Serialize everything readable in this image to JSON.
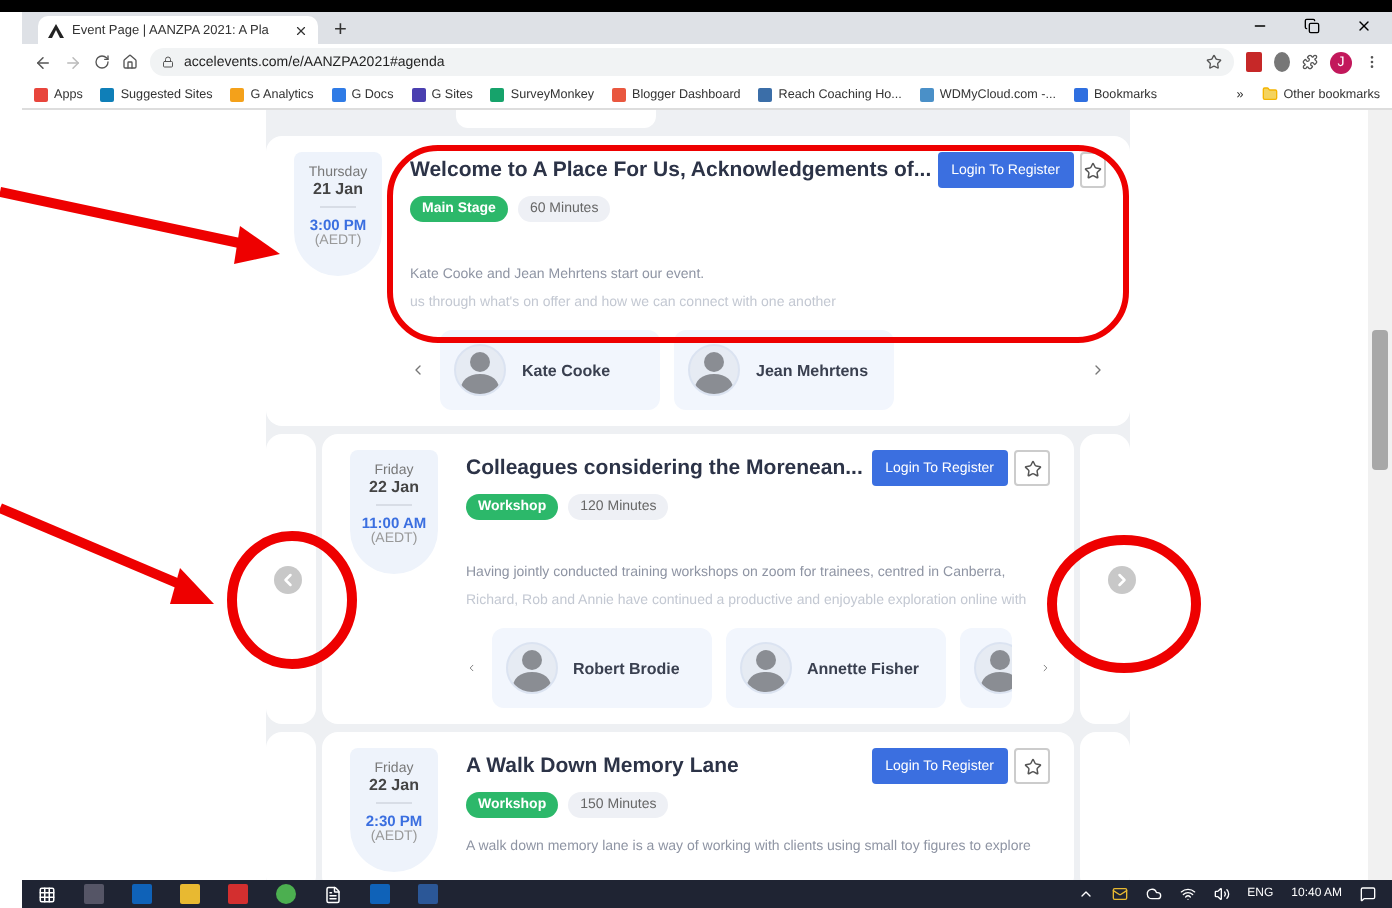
{
  "browser": {
    "tab_title": "Event Page | AANZPA 2021: A Pla",
    "new_tab": "+",
    "url": "accelevents.com/e/AANZPA2021#agenda",
    "avatar_initial": "J",
    "bookmarks": [
      {
        "label": "Apps",
        "color": "#e8453c"
      },
      {
        "label": "Suggested Sites",
        "color": "#0f7fb8"
      },
      {
        "label": "G Analytics",
        "color": "#f4a11a"
      },
      {
        "label": "G Docs",
        "color": "#2f7be6"
      },
      {
        "label": "G Sites",
        "color": "#4a3fb0"
      },
      {
        "label": "SurveyMonkey",
        "color": "#16a36b"
      },
      {
        "label": "Blogger Dashboard",
        "color": "#e9573f"
      },
      {
        "label": "Reach Coaching Ho...",
        "color": "#3b6ea8"
      },
      {
        "label": "WDMyCloud.com -...",
        "color": "#4a90c8"
      },
      {
        "label": "Bookmarks",
        "color": "#2f6fe0"
      }
    ],
    "overflow": "»",
    "other_bookmarks": "Other bookmarks"
  },
  "sessions": [
    {
      "day": "Thursday",
      "date": "21 Jan",
      "time": "3:00 PM",
      "zone": "(AEDT)",
      "title": "Welcome to A Place For Us, Acknowledgements of...",
      "button": "Login To Register",
      "track": "Main Stage",
      "duration": "60 Minutes",
      "carousel": false,
      "description": [
        "Kate Cooke and Jean Mehrtens start our event.",
        "us through what's on offer and how we can connect with one another"
      ],
      "speakers": [
        "Kate Cooke",
        "Jean Mehrtens"
      ]
    },
    {
      "day": "Friday",
      "date": "22 Jan",
      "time": "11:00 AM",
      "zone": "(AEDT)",
      "title": "Colleagues considering the Morenean...",
      "button": "Login To Register",
      "track": "Workshop",
      "duration": "120 Minutes",
      "carousel": true,
      "description": [
        "Having jointly conducted training workshops on zoom for trainees, centred in Canberra,",
        "Richard, Rob and Annie have continued a productive and enjoyable exploration online with"
      ],
      "speakers": [
        "Robert Brodie",
        "Annette Fisher"
      ],
      "clipped_speaker": true
    },
    {
      "day": "Friday",
      "date": "22 Jan",
      "time": "2:30 PM",
      "zone": "(AEDT)",
      "title": "A Walk Down Memory Lane",
      "button": "Login To Register",
      "track": "Workshop",
      "duration": "150 Minutes",
      "carousel": true,
      "description": [
        "A walk down memory lane is a way of working with clients using small toy figures to explore"
      ]
    }
  ],
  "taskbar": {
    "language": "ENG",
    "time": "10:40 AM"
  }
}
